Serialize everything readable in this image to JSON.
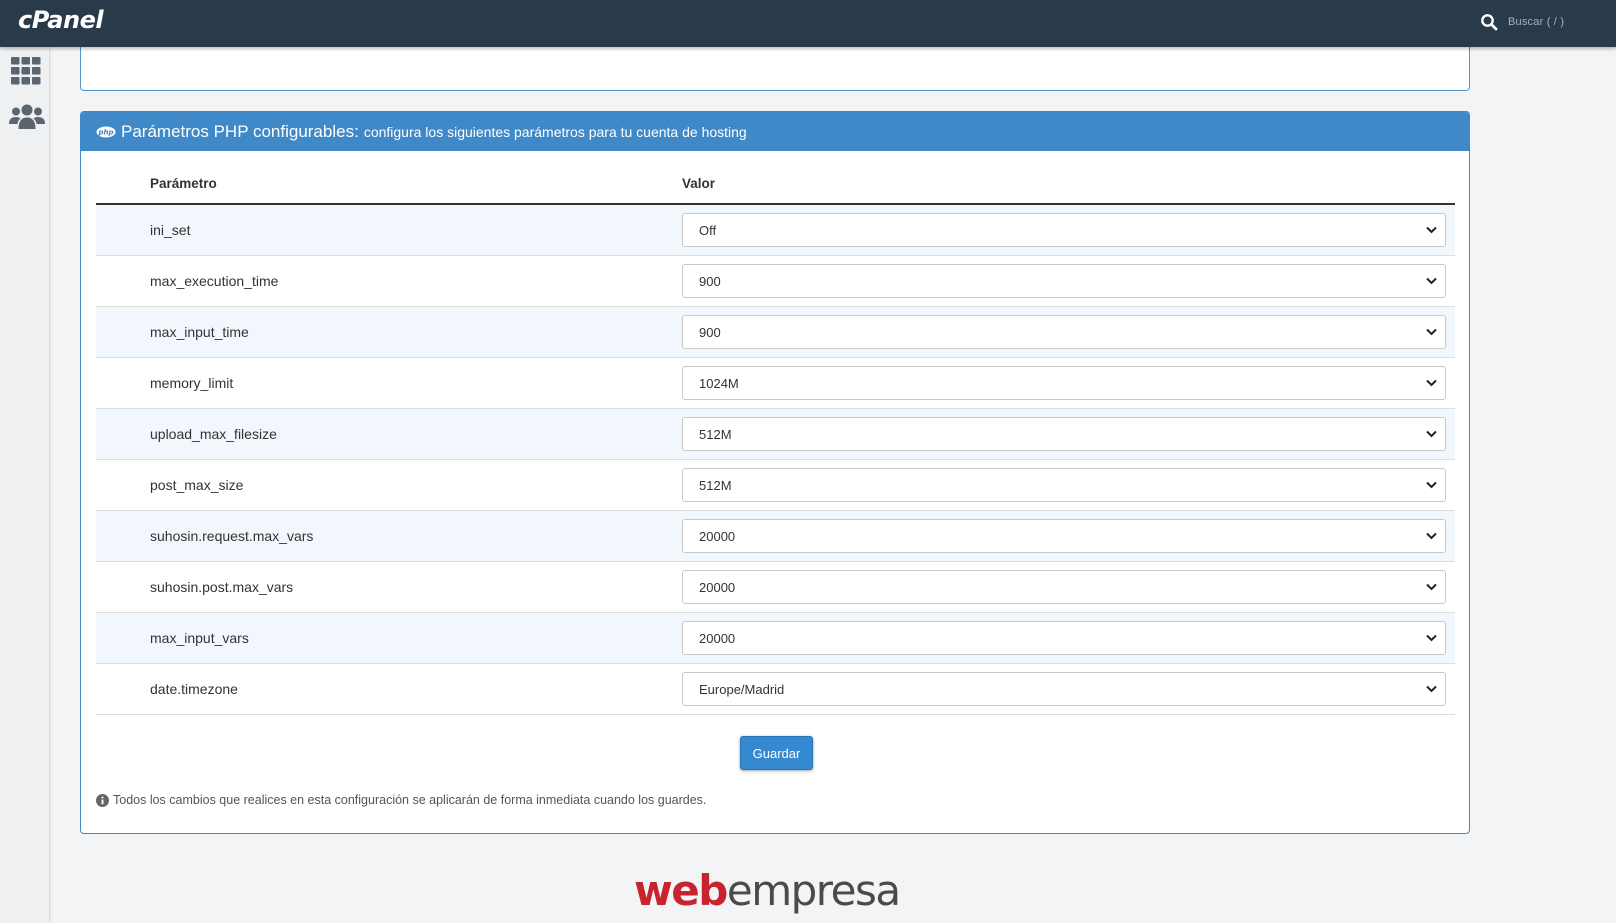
{
  "header": {
    "logo": "cPanel",
    "search_placeholder": "Buscar ( / )"
  },
  "sidebar": {
    "items": [
      {
        "icon": "apps-grid-icon"
      },
      {
        "icon": "users-icon"
      }
    ]
  },
  "panel": {
    "title": "Parámetros PHP configurables:",
    "subtitle": "configura los siguientes parámetros para tu cuenta de hosting",
    "table": {
      "headers": [
        "Parámetro",
        "Valor"
      ],
      "rows": [
        {
          "param": "ini_set",
          "value": "Off"
        },
        {
          "param": "max_execution_time",
          "value": "900"
        },
        {
          "param": "max_input_time",
          "value": "900"
        },
        {
          "param": "memory_limit",
          "value": "1024M"
        },
        {
          "param": "upload_max_filesize",
          "value": "512M"
        },
        {
          "param": "post_max_size",
          "value": "512M"
        },
        {
          "param": "suhosin.request.max_vars",
          "value": "20000"
        },
        {
          "param": "suhosin.post.max_vars",
          "value": "20000"
        },
        {
          "param": "max_input_vars",
          "value": "20000"
        },
        {
          "param": "date.timezone",
          "value": "Europe/Madrid"
        }
      ]
    },
    "save_label": "Guardar",
    "note": "Todos los cambios que realices en esta configuración se aplicarán de forma inmediata cuando los guardes."
  },
  "footer": {
    "brand_part1": "web",
    "brand_part2": "empresa"
  },
  "colors": {
    "topbar": "#293a4a",
    "panel_header": "#3f89c8",
    "button": "#3589d0",
    "brand_red": "#c8242f"
  }
}
